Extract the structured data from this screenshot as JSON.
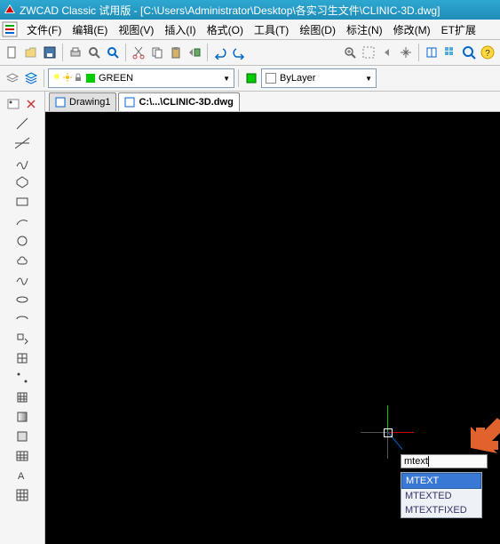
{
  "title": "ZWCAD Classic 试用版 - [C:\\Users\\Administrator\\Desktop\\各实习生文件\\CLINIC-3D.dwg]",
  "menu": {
    "file": "文件(F)",
    "edit": "编辑(E)",
    "view": "视图(V)",
    "insert": "插入(I)",
    "format": "格式(O)",
    "tools": "工具(T)",
    "draw": "绘图(D)",
    "dim": "标注(N)",
    "modify": "修改(M)",
    "et": "ET扩展"
  },
  "layer": {
    "current": "GREEN",
    "bylayer": "ByLayer"
  },
  "tabs": {
    "t1": "Drawing1",
    "t2": "C:\\...\\CLINIC-3D.dwg"
  },
  "cmd": {
    "input": "mtext",
    "s1": "MTEXT",
    "s2": "MTEXTED",
    "s3": "MTEXTFIXED"
  }
}
